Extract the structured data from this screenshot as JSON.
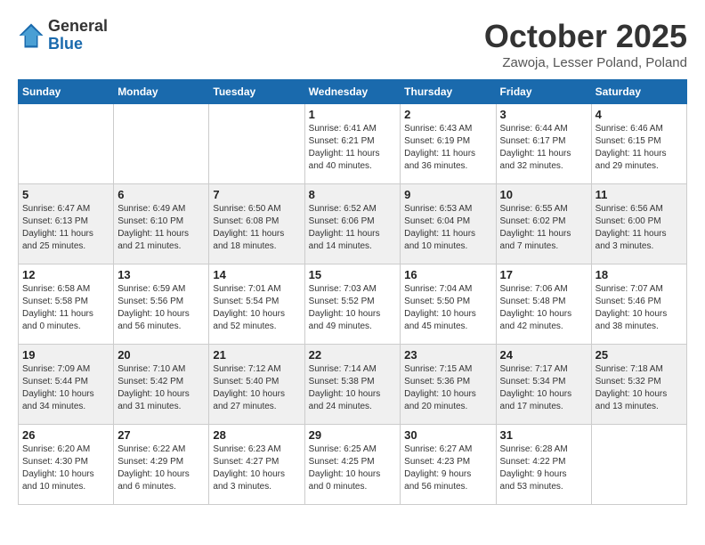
{
  "header": {
    "logo_general": "General",
    "logo_blue": "Blue",
    "month_title": "October 2025",
    "subtitle": "Zawoja, Lesser Poland, Poland"
  },
  "weekdays": [
    "Sunday",
    "Monday",
    "Tuesday",
    "Wednesday",
    "Thursday",
    "Friday",
    "Saturday"
  ],
  "weeks": [
    [
      {
        "day": "",
        "info": ""
      },
      {
        "day": "",
        "info": ""
      },
      {
        "day": "",
        "info": ""
      },
      {
        "day": "1",
        "info": "Sunrise: 6:41 AM\nSunset: 6:21 PM\nDaylight: 11 hours\nand 40 minutes."
      },
      {
        "day": "2",
        "info": "Sunrise: 6:43 AM\nSunset: 6:19 PM\nDaylight: 11 hours\nand 36 minutes."
      },
      {
        "day": "3",
        "info": "Sunrise: 6:44 AM\nSunset: 6:17 PM\nDaylight: 11 hours\nand 32 minutes."
      },
      {
        "day": "4",
        "info": "Sunrise: 6:46 AM\nSunset: 6:15 PM\nDaylight: 11 hours\nand 29 minutes."
      }
    ],
    [
      {
        "day": "5",
        "info": "Sunrise: 6:47 AM\nSunset: 6:13 PM\nDaylight: 11 hours\nand 25 minutes."
      },
      {
        "day": "6",
        "info": "Sunrise: 6:49 AM\nSunset: 6:10 PM\nDaylight: 11 hours\nand 21 minutes."
      },
      {
        "day": "7",
        "info": "Sunrise: 6:50 AM\nSunset: 6:08 PM\nDaylight: 11 hours\nand 18 minutes."
      },
      {
        "day": "8",
        "info": "Sunrise: 6:52 AM\nSunset: 6:06 PM\nDaylight: 11 hours\nand 14 minutes."
      },
      {
        "day": "9",
        "info": "Sunrise: 6:53 AM\nSunset: 6:04 PM\nDaylight: 11 hours\nand 10 minutes."
      },
      {
        "day": "10",
        "info": "Sunrise: 6:55 AM\nSunset: 6:02 PM\nDaylight: 11 hours\nand 7 minutes."
      },
      {
        "day": "11",
        "info": "Sunrise: 6:56 AM\nSunset: 6:00 PM\nDaylight: 11 hours\nand 3 minutes."
      }
    ],
    [
      {
        "day": "12",
        "info": "Sunrise: 6:58 AM\nSunset: 5:58 PM\nDaylight: 11 hours\nand 0 minutes."
      },
      {
        "day": "13",
        "info": "Sunrise: 6:59 AM\nSunset: 5:56 PM\nDaylight: 10 hours\nand 56 minutes."
      },
      {
        "day": "14",
        "info": "Sunrise: 7:01 AM\nSunset: 5:54 PM\nDaylight: 10 hours\nand 52 minutes."
      },
      {
        "day": "15",
        "info": "Sunrise: 7:03 AM\nSunset: 5:52 PM\nDaylight: 10 hours\nand 49 minutes."
      },
      {
        "day": "16",
        "info": "Sunrise: 7:04 AM\nSunset: 5:50 PM\nDaylight: 10 hours\nand 45 minutes."
      },
      {
        "day": "17",
        "info": "Sunrise: 7:06 AM\nSunset: 5:48 PM\nDaylight: 10 hours\nand 42 minutes."
      },
      {
        "day": "18",
        "info": "Sunrise: 7:07 AM\nSunset: 5:46 PM\nDaylight: 10 hours\nand 38 minutes."
      }
    ],
    [
      {
        "day": "19",
        "info": "Sunrise: 7:09 AM\nSunset: 5:44 PM\nDaylight: 10 hours\nand 34 minutes."
      },
      {
        "day": "20",
        "info": "Sunrise: 7:10 AM\nSunset: 5:42 PM\nDaylight: 10 hours\nand 31 minutes."
      },
      {
        "day": "21",
        "info": "Sunrise: 7:12 AM\nSunset: 5:40 PM\nDaylight: 10 hours\nand 27 minutes."
      },
      {
        "day": "22",
        "info": "Sunrise: 7:14 AM\nSunset: 5:38 PM\nDaylight: 10 hours\nand 24 minutes."
      },
      {
        "day": "23",
        "info": "Sunrise: 7:15 AM\nSunset: 5:36 PM\nDaylight: 10 hours\nand 20 minutes."
      },
      {
        "day": "24",
        "info": "Sunrise: 7:17 AM\nSunset: 5:34 PM\nDaylight: 10 hours\nand 17 minutes."
      },
      {
        "day": "25",
        "info": "Sunrise: 7:18 AM\nSunset: 5:32 PM\nDaylight: 10 hours\nand 13 minutes."
      }
    ],
    [
      {
        "day": "26",
        "info": "Sunrise: 6:20 AM\nSunset: 4:30 PM\nDaylight: 10 hours\nand 10 minutes."
      },
      {
        "day": "27",
        "info": "Sunrise: 6:22 AM\nSunset: 4:29 PM\nDaylight: 10 hours\nand 6 minutes."
      },
      {
        "day": "28",
        "info": "Sunrise: 6:23 AM\nSunset: 4:27 PM\nDaylight: 10 hours\nand 3 minutes."
      },
      {
        "day": "29",
        "info": "Sunrise: 6:25 AM\nSunset: 4:25 PM\nDaylight: 10 hours\nand 0 minutes."
      },
      {
        "day": "30",
        "info": "Sunrise: 6:27 AM\nSunset: 4:23 PM\nDaylight: 9 hours\nand 56 minutes."
      },
      {
        "day": "31",
        "info": "Sunrise: 6:28 AM\nSunset: 4:22 PM\nDaylight: 9 hours\nand 53 minutes."
      },
      {
        "day": "",
        "info": ""
      }
    ]
  ]
}
